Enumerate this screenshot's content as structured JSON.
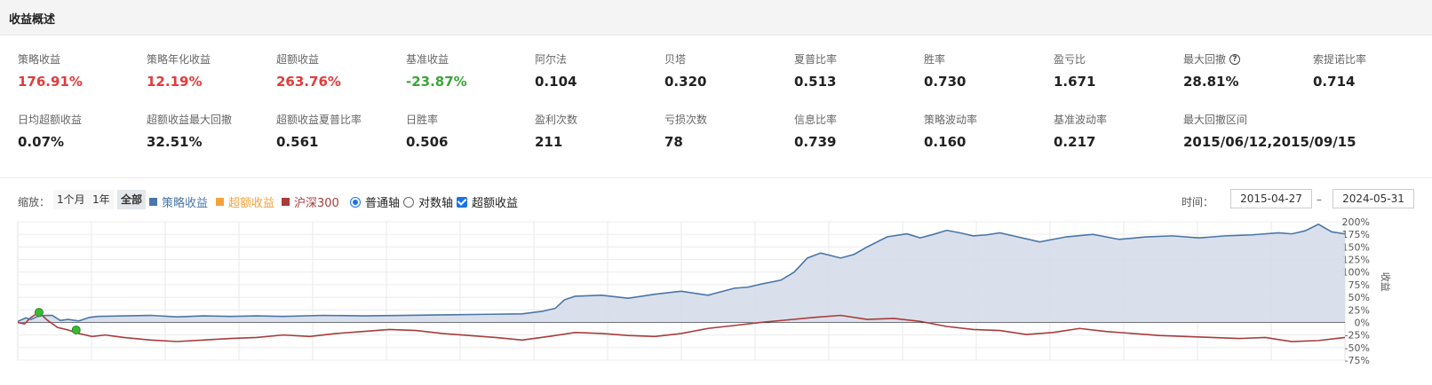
{
  "header": {
    "title": "收益概述"
  },
  "metrics_row1": [
    {
      "label": "策略收益",
      "value": "176.91%",
      "tone": "red"
    },
    {
      "label": "策略年化收益",
      "value": "12.19%",
      "tone": "red"
    },
    {
      "label": "超额收益",
      "value": "263.76%",
      "tone": "red"
    },
    {
      "label": "基准收益",
      "value": "-23.87%",
      "tone": "green"
    },
    {
      "label": "阿尔法",
      "value": "0.104",
      "tone": ""
    },
    {
      "label": "贝塔",
      "value": "0.320",
      "tone": ""
    },
    {
      "label": "夏普比率",
      "value": "0.513",
      "tone": ""
    },
    {
      "label": "胜率",
      "value": "0.730",
      "tone": ""
    },
    {
      "label": "盈亏比",
      "value": "1.671",
      "tone": ""
    },
    {
      "label": "最大回撤",
      "value": "28.81%",
      "tone": "",
      "help": true
    },
    {
      "label": "索提诺比率",
      "value": "0.714",
      "tone": ""
    }
  ],
  "metrics_row2": [
    {
      "label": "日均超额收益",
      "value": "0.07%"
    },
    {
      "label": "超额收益最大回撤",
      "value": "32.51%"
    },
    {
      "label": "超额收益夏普比率",
      "value": "0.561"
    },
    {
      "label": "日胜率",
      "value": "0.506"
    },
    {
      "label": "盈利次数",
      "value": "211"
    },
    {
      "label": "亏损次数",
      "value": "78"
    },
    {
      "label": "信息比率",
      "value": "0.739"
    },
    {
      "label": "策略波动率",
      "value": "0.160"
    },
    {
      "label": "基准波动率",
      "value": "0.217"
    },
    {
      "label": "最大回撤区间",
      "value": "2015/06/12,2015/09/15"
    }
  ],
  "toolbar": {
    "zoom_label": "缩放：",
    "zoom_options": [
      "1个月",
      "1年",
      "全部"
    ],
    "legend": [
      {
        "label": "策略收益",
        "color": "#4a76a8"
      },
      {
        "label": "超额收益",
        "color": "#f5a33c"
      },
      {
        "label": "沪深300",
        "color": "#a83b3b"
      }
    ],
    "axis_normal": "普通轴",
    "axis_log": "对数轴",
    "excess_toggle": "超额收益",
    "time_label": "时间：",
    "start_date": "2015-04-27",
    "end_date": "2024-05-31"
  },
  "colors": {
    "strategy": "#4a76a8",
    "benchmark": "#a83b3b",
    "excess": "#f5a33c",
    "marker": "#3cb832"
  },
  "chart_data": {
    "type": "line",
    "y_axis_title": "收益",
    "ylim": [
      -75,
      200
    ],
    "y_ticks": [
      "200%",
      "175%",
      "150%",
      "125%",
      "100%",
      "75%",
      "50%",
      "25%",
      "0%",
      "-25%",
      "-50%",
      "-75%"
    ],
    "grid": true,
    "x_range": [
      0,
      100
    ],
    "series": [
      {
        "name": "策略收益",
        "x": [
          0,
          0.6,
          1.0,
          1.5,
          2.0,
          2.6,
          3.2,
          3.8,
          4.6,
          5.4,
          6.0,
          8.0,
          10,
          12,
          14,
          16,
          18,
          20,
          23,
          26,
          29,
          32,
          35,
          38,
          39.5,
          40.5,
          41.2,
          42,
          44,
          46,
          48,
          50,
          52,
          54,
          55,
          56,
          57.5,
          58.5,
          59.5,
          60.5,
          62,
          63,
          64,
          65.5,
          67,
          68,
          69,
          70,
          71,
          72,
          73,
          74,
          75,
          77,
          79,
          81,
          83,
          85,
          87,
          89,
          91,
          93,
          95,
          96,
          97,
          98,
          99,
          100
        ],
        "values": [
          2,
          9,
          6,
          12,
          14,
          14,
          4,
          6,
          3,
          10,
          12,
          13,
          14,
          11,
          13,
          12,
          13,
          12,
          14,
          13,
          14,
          15,
          16,
          17,
          22,
          28,
          45,
          52,
          54,
          48,
          56,
          62,
          54,
          68,
          70,
          76,
          84,
          100,
          128,
          138,
          128,
          135,
          150,
          170,
          176,
          168,
          175,
          183,
          178,
          172,
          174,
          178,
          172,
          160,
          170,
          175,
          165,
          170,
          172,
          168,
          172,
          174,
          178,
          176,
          182,
          195,
          180,
          176
        ]
      },
      {
        "name": "沪深300",
        "x": [
          0,
          0.5,
          1.0,
          1.6,
          2.2,
          3.0,
          3.8,
          4.6,
          5.6,
          6.6,
          8,
          10,
          12,
          14,
          16,
          18,
          20,
          22,
          24,
          26,
          28,
          30,
          32,
          34,
          36,
          38,
          40,
          42,
          44,
          46,
          48,
          50,
          52,
          54,
          56,
          58,
          60,
          62,
          64,
          66,
          68,
          70,
          72,
          74,
          76,
          78,
          80,
          82,
          84,
          86,
          88,
          90,
          92,
          94,
          96,
          98,
          100
        ],
        "values": [
          0,
          -3,
          10,
          20,
          5,
          -10,
          -15,
          -22,
          -28,
          -25,
          -30,
          -35,
          -38,
          -35,
          -32,
          -30,
          -25,
          -28,
          -22,
          -18,
          -14,
          -16,
          -22,
          -26,
          -30,
          -35,
          -28,
          -20,
          -22,
          -26,
          -28,
          -22,
          -12,
          -6,
          0,
          5,
          10,
          14,
          6,
          8,
          2,
          -8,
          -14,
          -16,
          -24,
          -20,
          -12,
          -18,
          -22,
          -26,
          -28,
          -30,
          -32,
          -30,
          -38,
          -36,
          -30
        ]
      },
      {
        "name": "超额收益",
        "x": [],
        "values": []
      }
    ],
    "markers": [
      {
        "series": "策略收益",
        "x": 1.6,
        "y": 20
      },
      {
        "series": "沪深300",
        "x": 4.4,
        "y": -15
      }
    ]
  }
}
